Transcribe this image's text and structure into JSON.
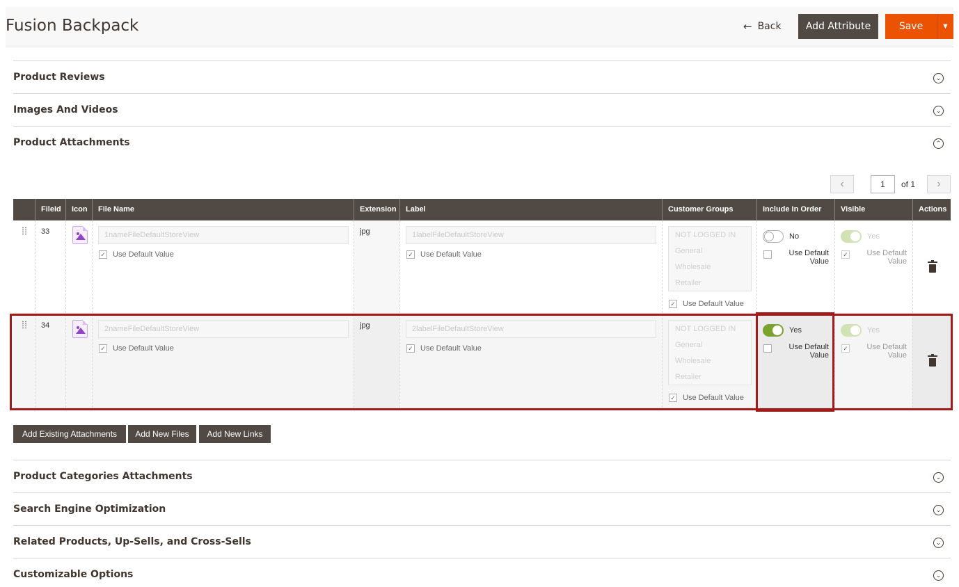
{
  "header": {
    "title": "Fusion Backpack",
    "back_label": "Back",
    "add_attribute_label": "Add Attribute",
    "save_label": "Save"
  },
  "sections_top": [
    {
      "title": "Product Reviews"
    },
    {
      "title": "Images And Videos"
    },
    {
      "title": "Product Attachments"
    }
  ],
  "pager": {
    "current": "1",
    "of_label": "of 1"
  },
  "table": {
    "columns": [
      "FileId",
      "Icon",
      "File Name",
      "Extension",
      "Label",
      "Customer Groups",
      "Include In Order",
      "Visible",
      "Actions"
    ],
    "rows": [
      {
        "file_id": "33",
        "file_name": "1nameFileDefaultStoreView",
        "extension": "jpg",
        "label": "1labelFileDefaultStoreView",
        "use_default_value": "Use Default Value",
        "customer_groups": [
          "NOT LOGGED IN",
          "General",
          "Wholesale",
          "Retailer"
        ],
        "include_in_order": "No",
        "include_use_default": "Use Default Value",
        "visible": "Yes",
        "visible_use_default": "Use Default Value"
      },
      {
        "file_id": "34",
        "file_name": "2nameFileDefaultStoreView",
        "extension": "jpg",
        "label": "2labelFileDefaultStoreView",
        "use_default_value": "Use Default Value",
        "customer_groups": [
          "NOT LOGGED IN",
          "General",
          "Wholesale",
          "Retailer"
        ],
        "include_in_order": "Yes",
        "include_use_default": "Use Default Value",
        "visible": "Yes",
        "visible_use_default": "Use Default Value"
      }
    ]
  },
  "buttons": {
    "add_existing": "Add Existing Attachments",
    "add_new_files": "Add New Files",
    "add_new_links": "Add New Links"
  },
  "sections_bottom": [
    {
      "title": "Product Categories Attachments"
    },
    {
      "title": "Search Engine Optimization"
    },
    {
      "title": "Related Products, Up-Sells, and Cross-Sells"
    },
    {
      "title": "Customizable Options"
    }
  ],
  "colors": {
    "accent": "#eb5202",
    "dark": "#514943",
    "toggle_on": "#79a22e",
    "highlight": "#a31a1a"
  }
}
